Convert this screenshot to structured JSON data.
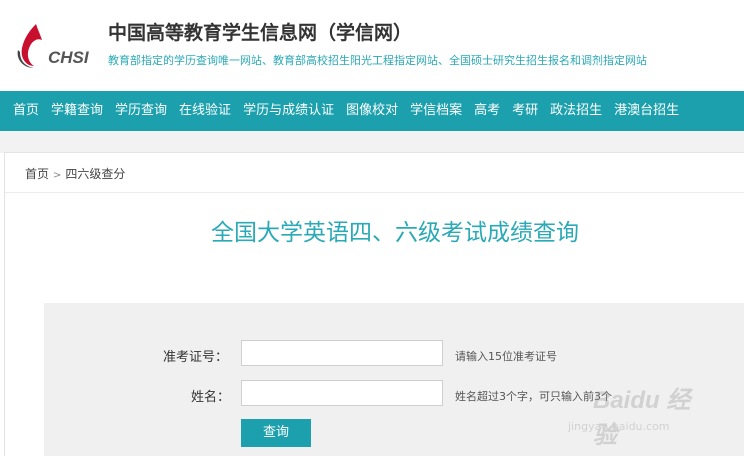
{
  "header": {
    "logo_text": "CHSI",
    "title": "中国高等教育学生信息网（学信网）",
    "subtitle": "教育部指定的学历查询唯一网站、教育部高校招生阳光工程指定网站、全国硕士研究生招生报名和调剂指定网站"
  },
  "nav": {
    "items": [
      "首页",
      "学籍查询",
      "学历查询",
      "在线验证",
      "学历与成绩认证",
      "图像校对",
      "学信档案",
      "高考",
      "考研",
      "政法招生",
      "港澳台招生"
    ]
  },
  "breadcrumb": {
    "home": "首页",
    "separator": ">",
    "current": "四六级查分"
  },
  "main": {
    "title": "全国大学英语四、六级考试成绩查询"
  },
  "form": {
    "ticket_label": "准考证号：",
    "ticket_value": "",
    "ticket_hint": "请输入15位准考证号",
    "name_label": "姓名：",
    "name_value": "",
    "name_hint": "姓名超过3个字，可只输入前3个",
    "submit_label": "查询"
  },
  "watermark": {
    "brand": "Baidu 经验",
    "url": "jingyan.baidu.com"
  },
  "colors": {
    "accent": "#1da0ad",
    "title_teal": "#2aa9b6",
    "logo_red": "#c8102e"
  }
}
